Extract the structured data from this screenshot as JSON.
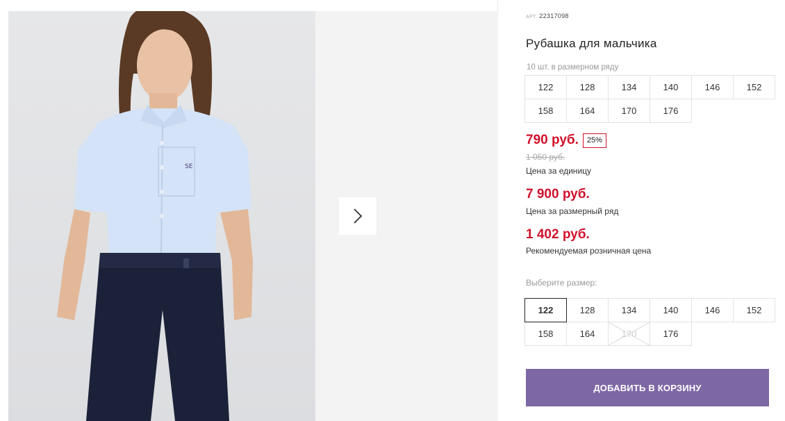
{
  "product": {
    "article_label": "АРТ.",
    "article_value": "22317098",
    "title": "Рубашка для мальчика",
    "pack_note": "10 шт. в размерном ряду"
  },
  "pack_sizes": [
    "122",
    "128",
    "134",
    "140",
    "146",
    "152",
    "158",
    "164",
    "170",
    "176"
  ],
  "prices": {
    "unit_price": "790 руб.",
    "discount_badge": "25%",
    "old_price": "1 050 руб.",
    "unit_caption": "Цена за единицу",
    "pack_price": "7 900 руб.",
    "pack_caption": "Цена за размерный ряд",
    "retail_price": "1 402 руб.",
    "retail_caption": "Рекомендуемая розничная цена"
  },
  "size_picker": {
    "label": "Выберите размер:",
    "options": [
      {
        "label": "122",
        "state": "selected"
      },
      {
        "label": "128",
        "state": "available"
      },
      {
        "label": "134",
        "state": "available"
      },
      {
        "label": "140",
        "state": "available"
      },
      {
        "label": "146",
        "state": "available"
      },
      {
        "label": "152",
        "state": "available"
      },
      {
        "label": "158",
        "state": "available"
      },
      {
        "label": "164",
        "state": "available"
      },
      {
        "label": "170",
        "state": "unavailable"
      },
      {
        "label": "176",
        "state": "available"
      }
    ]
  },
  "actions": {
    "add_to_cart": "ДОБАВИТЬ В КОРЗИНУ"
  },
  "gallery": {
    "next_icon": "chevron-right-icon"
  },
  "colors": {
    "price_red": "#d0112b",
    "button_purple": "#7e67a5",
    "shirt_blue": "#d4e3f7",
    "pants_navy": "#1b2138"
  }
}
